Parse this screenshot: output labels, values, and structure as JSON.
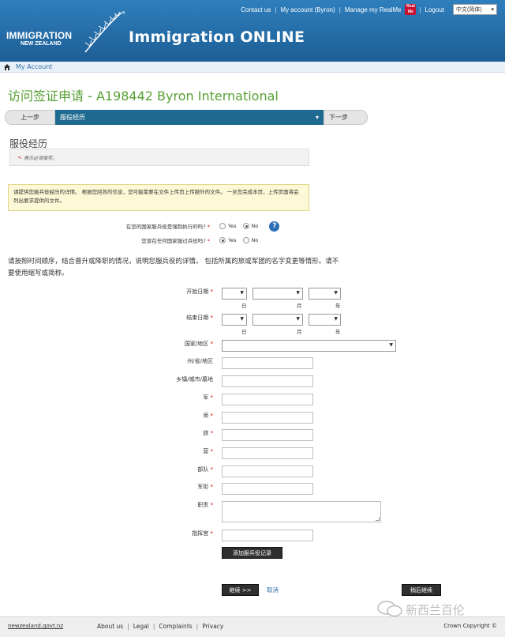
{
  "header": {
    "logo_line1": "IMMIGRATION",
    "logo_line2": "NEW ZEALAND",
    "logo_reg": "®",
    "app_title": "Immigration ONLINE",
    "links": {
      "contact": "Contact us",
      "account": "My account (Byron)",
      "realme": "Manage my RealMe",
      "realme_icon_text": "Real Me",
      "logout": "Logout"
    },
    "language": "中文(简体)"
  },
  "breadcrumb": {
    "label": "My Account"
  },
  "page_title": "访问签证申请 - A198442 Byron International",
  "nav": {
    "prev": "上一步",
    "current": "服役经历",
    "next": "下一步"
  },
  "section_title": "服役经历",
  "required_note": {
    "star": "*",
    "text": "- 表示必须填写。"
  },
  "info_box": "请提供您服兵役经历的详情。 根据您回答的信息，您可能需要在文件上传页上传额外的文件。 一旦您完成本页，上传页面将会列出要求提供的文件。",
  "questions": [
    {
      "label": "在您的国家服兵役是强制执行的吗?",
      "star": "*",
      "yes": "Yes",
      "no": "No",
      "selected": "No"
    },
    {
      "label": "您曾在任何国家服过兵役吗?",
      "star": "*",
      "yes": "Yes",
      "no": "No",
      "selected": "Yes"
    }
  ],
  "help_icon": "?",
  "instructions": "请按照时间顺序，结合晋升或降职的情况，说明您服兵役的详情。 包括所属的旅或军团的名字变更等情形。请不要使用缩写或简称。",
  "form": {
    "start_date": {
      "label": "开始日期",
      "star": "*"
    },
    "end_date": {
      "label": "结束日期",
      "star": "*"
    },
    "date_units": {
      "day": "日",
      "month": "月",
      "year": "年"
    },
    "country": {
      "label": "国家/地区",
      "star": "*"
    },
    "state": {
      "label": "州/省/地区"
    },
    "town": {
      "label": "乡镇/城市/墓地"
    },
    "army": {
      "label": "军",
      "star": "*"
    },
    "division": {
      "label": "师",
      "star": "*"
    },
    "brigade": {
      "label": "旅",
      "star": "*"
    },
    "battalion": {
      "label": "营",
      "star": "*"
    },
    "unit": {
      "label": "部队",
      "star": "*"
    },
    "rank": {
      "label": "军衔",
      "star": "*"
    },
    "duties": {
      "label": "职责",
      "star": "*"
    },
    "commander": {
      "label": "指挥官",
      "star": "*"
    },
    "add_record_button": "添加服兵役记录"
  },
  "actions": {
    "continue": "继续 >>",
    "cancel": "取消",
    "save_later": "稍后继续"
  },
  "footer": {
    "govt": "newzealand.govt.nz",
    "links": [
      "About us",
      "Legal",
      "Complaints",
      "Privacy"
    ],
    "separator": "|",
    "copyright": "Crown Copyright ©"
  },
  "watermark": "新西兰百伦",
  "colors": {
    "header_blue": "#1d5e95",
    "title_green": "#57a134",
    "nav_select_blue": "#1f6a90",
    "required_red": "#cc0000",
    "info_box_yellow": "#fdf9d6"
  }
}
